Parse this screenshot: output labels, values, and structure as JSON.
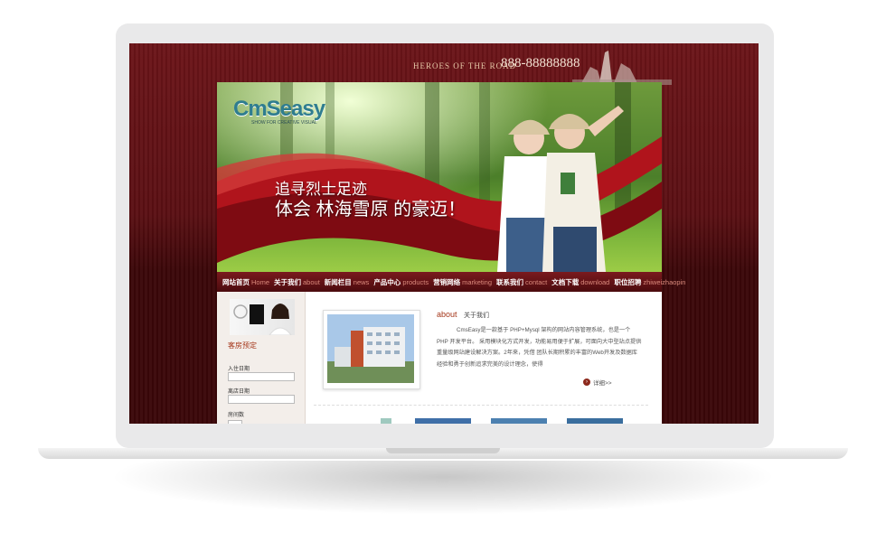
{
  "header": {
    "tagline": "HEROES OF THE ROAD",
    "phone": "888-88888888"
  },
  "banner": {
    "logo": "CmSeasy",
    "logo_sub": "SHOW FOR CREATIVE VISUAL",
    "slogan_line1": "追寻烈士足迹",
    "slogan_line2": "体会 林海雪原 的豪迈！"
  },
  "nav": {
    "items": [
      {
        "cn": "网站首页",
        "en": "Home"
      },
      {
        "cn": "关于我们",
        "en": "about"
      },
      {
        "cn": "新闻栏目",
        "en": "news"
      },
      {
        "cn": "产品中心",
        "en": "products"
      },
      {
        "cn": "营销网络",
        "en": "marketing"
      },
      {
        "cn": "联系我们",
        "en": "contact"
      },
      {
        "cn": "文档下载",
        "en": "download"
      },
      {
        "cn": "职位招聘",
        "en": "zhiweizhaopin"
      }
    ]
  },
  "sidebar": {
    "title": "客房预定",
    "checkin_label": "入住日期",
    "checkout_label": "离店日期",
    "rooms_label": "房间数"
  },
  "about": {
    "heading": "about",
    "subheading": "关于我们",
    "text": "CmsEasy是一款基于 PHP+Mysql 架构的网站内容管理系统，也是一个 PHP 开发平台。 采用模块化方式开发，功能易用便于扩展，可面向大中型站点提供重量级网站建设解决方案。2年来，凭借 团队长期积累的丰富的Web开发及数据库经验和勇于创新追求完美的设计理念，使得",
    "more": "详细>>"
  },
  "colors": {
    "maroon": "#5a0f13",
    "accent": "#a5371b",
    "nav_en": "#d98a7c"
  }
}
